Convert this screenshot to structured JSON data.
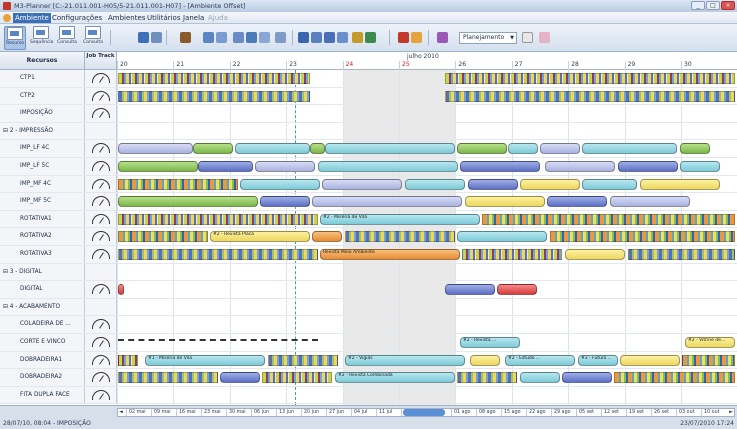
{
  "window": {
    "title": "M3-Planner [C:-21.011.001-H05/5-21.011.001-H07] - [Ambiente Offset]",
    "buttons": [
      "_",
      "□",
      "×"
    ]
  },
  "menu": {
    "items": [
      "Ambiente",
      "Configurações",
      "Ambientes",
      "Utilitários",
      "Janela",
      "Ajuda"
    ]
  },
  "toolbar": {
    "big_buttons": [
      "Recurso",
      "Sequência",
      "Consulta",
      "Consulta"
    ],
    "view_select": "Planejamento"
  },
  "gantt": {
    "header": {
      "resources": "Recursos",
      "job_track": "Job Track",
      "month": "julho 2010"
    },
    "days": [
      {
        "label": "20",
        "weekend": false
      },
      {
        "label": "21",
        "weekend": false
      },
      {
        "label": "22",
        "weekend": false
      },
      {
        "label": "23",
        "weekend": false
      },
      {
        "label": "24",
        "weekend": true
      },
      {
        "label": "25",
        "weekend": true
      },
      {
        "label": "26",
        "weekend": false
      },
      {
        "label": "27",
        "weekend": false
      },
      {
        "label": "28",
        "weekend": false
      },
      {
        "label": "29",
        "weekend": false
      },
      {
        "label": "30",
        "weekend": false
      }
    ],
    "rows": [
      {
        "name": "CTP1",
        "group": false
      },
      {
        "name": "CTP2",
        "group": false
      },
      {
        "name": "IMPOSIÇÃO",
        "group": false
      },
      {
        "name": "⊟ 2 - IMPRESSÃO",
        "group": true
      },
      {
        "name": "IMP_LF 4C",
        "group": false
      },
      {
        "name": "IMP_LF 5C",
        "group": false
      },
      {
        "name": "IMP_MF 4C",
        "group": false
      },
      {
        "name": "IMP_MF 5C",
        "group": false
      },
      {
        "name": "ROTATIVA1",
        "group": false
      },
      {
        "name": "ROTATIVA2",
        "group": false
      },
      {
        "name": "ROTATIVA3",
        "group": false
      },
      {
        "name": "⊟ 3 - DIGITAL",
        "group": true
      },
      {
        "name": "DIGITAL",
        "group": false
      },
      {
        "name": "⊟ 4 - ACABAMENTO",
        "group": true
      },
      {
        "name": "COLADEIRA DE ...",
        "group": false
      },
      {
        "name": "CORTE E VINCO",
        "group": false
      },
      {
        "name": "DOBRADEIRA1",
        "group": false
      },
      {
        "name": "DOBRADEIRA2",
        "group": false
      },
      {
        "name": "FITA DUPLA FACE",
        "group": false
      }
    ],
    "bar_labels": {
      "rot1": "#2 - Miséria de Vila",
      "rot2": "#2 - Revista Placa",
      "rot3": "Revista Meio Ambiente",
      "dob1a": "#1 - Miséria de Vila",
      "dob1b": "#2 - Vigias",
      "dob1c": "#2 - Estudo ...",
      "dob1d": "#3 - Futuro ...",
      "dob2a": "#2 - Revista Combinada",
      "cv1": "#2 - Revista ...",
      "cv2": "#2 - Vitrine de..."
    }
  },
  "timeline": {
    "ticks": [
      "02 mai",
      "09 mai",
      "16 mai",
      "23 mai",
      "30 mai",
      "06 jun",
      "13 jun",
      "20 jun",
      "27 jun",
      "04 jul",
      "11 jul",
      "18 jul",
      "25 jul",
      "01 ago",
      "08 ago",
      "15 ago",
      "22 ago",
      "29 ago",
      "05 set",
      "12 set",
      "19 set",
      "26 set",
      "03 out",
      "10 out"
    ]
  },
  "status": {
    "left": "28/07/10, 08:04 - IMPOSIÇÃO",
    "right": "23/07/2010 17:24"
  }
}
